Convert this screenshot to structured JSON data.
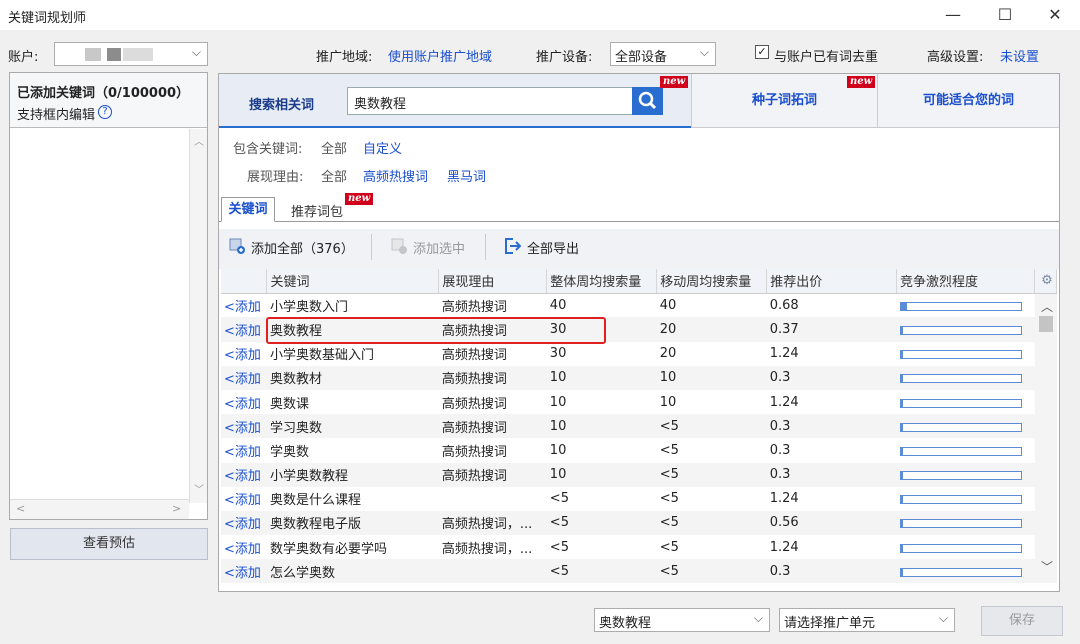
{
  "window": {
    "title": "关键词规划师",
    "minimize": "—",
    "maximize": "☐",
    "close": "✕"
  },
  "toolbar": {
    "account_label": "账户:",
    "region_label": "推广地域:",
    "region_value": "使用账户推广地域",
    "device_label": "推广设备:",
    "device_value": "全部设备",
    "dedupe_label": "与账户已有词去重",
    "dedupe_checked": true,
    "advanced_label": "高级设置:",
    "advanced_value": "未设置"
  },
  "left": {
    "added_title": "已添加关键词（0/100000）",
    "edit_hint": "支持框内编辑",
    "help_icon": "?",
    "preview_button": "查看预估"
  },
  "search": {
    "tab_label": "搜索相关词",
    "query": "奥数教程",
    "seed_tab": "种子词拓词",
    "suggest_tab": "可能适合您的词",
    "new_badge": "new"
  },
  "filters": {
    "include_label": "包含关键词:",
    "include_all": "全部",
    "include_custom": "自定义",
    "reason_label": "展现理由:",
    "reason_all": "全部",
    "reason_hot": "高频热搜词",
    "reason_dark": "黑马词"
  },
  "subtabs": {
    "keywords": "关键词",
    "recommended": "推荐词包"
  },
  "actions": {
    "add_all": "添加全部（376）",
    "add_selected": "添加选中",
    "export_all": "全部导出"
  },
  "table": {
    "headers": [
      "",
      "关键词",
      "展现理由",
      "整体周均搜索量",
      "移动周均搜索量",
      "推荐出价",
      "竞争激烈程度"
    ],
    "add_label": "<添加",
    "rows": [
      {
        "kw": "小学奥数入门",
        "reason": "高频热搜词",
        "overall": "40",
        "mobile": "40",
        "bid": "0.68",
        "comp": 0.05
      },
      {
        "kw": "奥数教程",
        "reason": "高频热搜词",
        "overall": "30",
        "mobile": "20",
        "bid": "0.37",
        "comp": 0.02
      },
      {
        "kw": "小学奥数基础入门",
        "reason": "高频热搜词",
        "overall": "30",
        "mobile": "20",
        "bid": "1.24",
        "comp": 0.02
      },
      {
        "kw": "奥数教材",
        "reason": "高频热搜词",
        "overall": "10",
        "mobile": "10",
        "bid": "0.3",
        "comp": 0.02
      },
      {
        "kw": "奥数课",
        "reason": "高频热搜词",
        "overall": "10",
        "mobile": "10",
        "bid": "1.24",
        "comp": 0.02
      },
      {
        "kw": "学习奥数",
        "reason": "高频热搜词",
        "overall": "10",
        "mobile": "<5",
        "bid": "0.3",
        "comp": 0.02
      },
      {
        "kw": "学奥数",
        "reason": "高频热搜词",
        "overall": "10",
        "mobile": "<5",
        "bid": "0.3",
        "comp": 0.02
      },
      {
        "kw": "小学奥数教程",
        "reason": "高频热搜词",
        "overall": "10",
        "mobile": "<5",
        "bid": "0.3",
        "comp": 0.02
      },
      {
        "kw": "奥数是什么课程",
        "reason": "",
        "overall": "<5",
        "mobile": "<5",
        "bid": "1.24",
        "comp": 0.02
      },
      {
        "kw": "奥数教程电子版",
        "reason": "高频热搜词，...",
        "overall": "<5",
        "mobile": "<5",
        "bid": "0.56",
        "comp": 0.02
      },
      {
        "kw": "数学奥数有必要学吗",
        "reason": "高频热搜词，...",
        "overall": "<5",
        "mobile": "<5",
        "bid": "1.24",
        "comp": 0.02
      },
      {
        "kw": "怎么学奥数",
        "reason": "",
        "overall": "<5",
        "mobile": "<5",
        "bid": "0.3",
        "comp": 0.02
      }
    ]
  },
  "bottom": {
    "plan_value": "奥数教程",
    "unit_placeholder": "请选择推广单元",
    "save_button": "保存"
  },
  "colors": {
    "accent": "#1a4fcf",
    "highlight": "#e02020",
    "new_badge": "#d0021b",
    "search_button": "#2a6dd1"
  }
}
